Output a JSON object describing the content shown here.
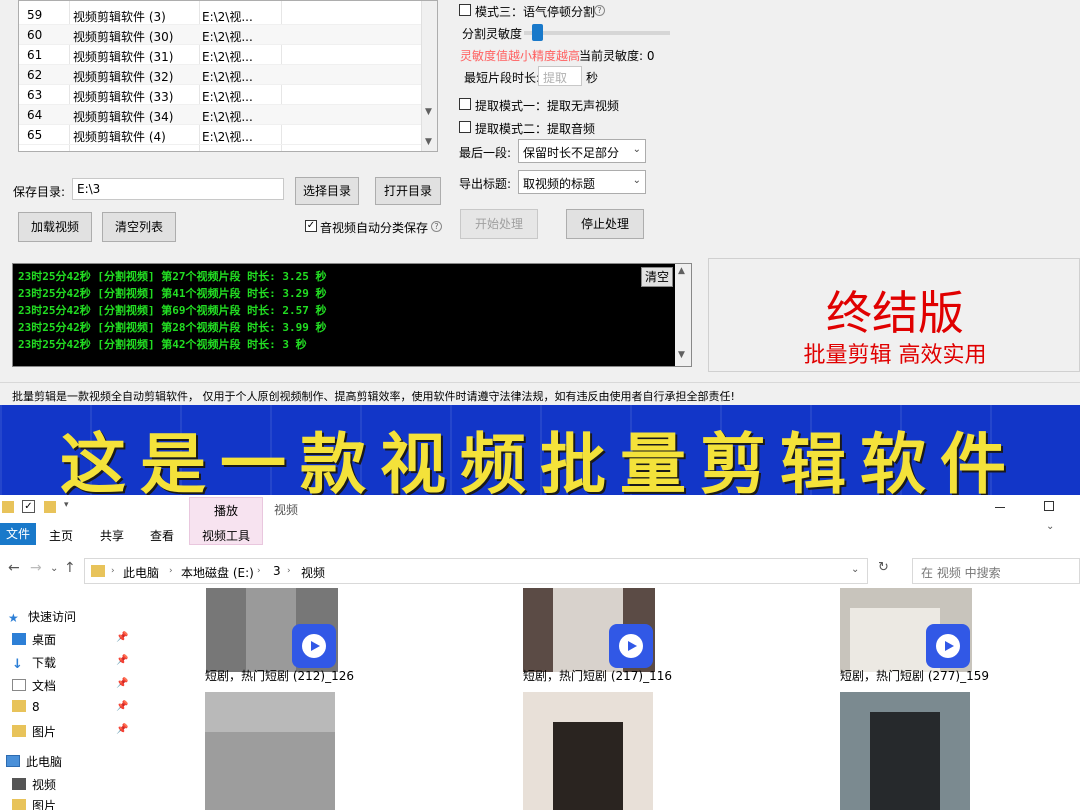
{
  "file_table": {
    "rows": [
      {
        "num": "59",
        "name": "视频剪辑软件 (3)",
        "path": "E:\\2\\视..."
      },
      {
        "num": "60",
        "name": "视频剪辑软件 (30)",
        "path": "E:\\2\\视..."
      },
      {
        "num": "61",
        "name": "视频剪辑软件 (31)",
        "path": "E:\\2\\视..."
      },
      {
        "num": "62",
        "name": "视频剪辑软件 (32)",
        "path": "E:\\2\\视..."
      },
      {
        "num": "63",
        "name": "视频剪辑软件 (33)",
        "path": "E:\\2\\视..."
      },
      {
        "num": "64",
        "name": "视频剪辑软件 (34)",
        "path": "E:\\2\\视..."
      },
      {
        "num": "65",
        "name": "视频剪辑软件 (4)",
        "path": "E:\\2\\视..."
      }
    ]
  },
  "save_dir": {
    "label": "保存目录:",
    "value": "E:\\3",
    "select_button": "选择目录",
    "open_button": "打开目录"
  },
  "buttons": {
    "add_video": "加载视频",
    "clear_list": "清空列表",
    "start": "开始处理",
    "stop": "停止处理",
    "clear_log": "清空"
  },
  "auto_classify": {
    "label": "音视频自动分类保存",
    "checked": true
  },
  "right_panel": {
    "mode3_label": "模式三：语气停顿分割",
    "sensitivity_label": "分割灵敏度",
    "sensitivity_hint": "灵敏度值越小精度越高",
    "current_sensitivity": "当前灵敏度: 0",
    "min_segment_label": "最短片段时长:",
    "min_segment_placeholder": "提取",
    "seconds_unit": "秒",
    "extract_mode1": "提取模式一：提取无声视频",
    "extract_mode2": "提取模式二：提取音频",
    "last_segment_label": "最后一段:",
    "last_segment_value": "保留时长不足部分",
    "export_title_label": "导出标题:",
    "export_title_value": "取视频的标题"
  },
  "log_lines": [
    "23时25分42秒 [分割视频] 第27个视频片段 时长: 3.25 秒",
    "23时25分42秒 [分割视频] 第41个视频片段 时长: 3.29 秒",
    "23时25分42秒 [分割视频] 第69个视频片段 时长: 2.57 秒",
    "23时25分42秒 [分割视频] 第28个视频片段 时长: 3.99 秒",
    "23时25分42秒 [分割视频] 第42个视频片段 时长: 3 秒"
  ],
  "promo": {
    "title": "终结版",
    "subtitle": "批量剪辑 高效实用"
  },
  "disclaimer": "批量剪辑是一款视频全自动剪辑软件， 仅用于个人原创视频制作、提高剪辑效率，使用软件时请遵守法律法规，如有违反由使用者自行承担全部责任!",
  "banner_text": "这是一款视频批量剪辑软件",
  "explorer": {
    "ribbon": {
      "play_tab": "播放",
      "video_label": "视频",
      "file_tab": "文件",
      "home_tab": "主页",
      "share_tab": "共享",
      "view_tab": "查看",
      "video_tools_tab": "视频工具"
    },
    "breadcrumb": [
      "此电脑",
      "本地磁盘 (E:)",
      "3",
      "视频"
    ],
    "search_placeholder": "在 视频 中搜索",
    "nav_pane": [
      {
        "label": "快速访问",
        "icon": "star-icon"
      },
      {
        "label": "桌面",
        "icon": "desktop-icon"
      },
      {
        "label": "下载",
        "icon": "download-icon"
      },
      {
        "label": "文档",
        "icon": "document-icon"
      },
      {
        "label": "8",
        "icon": "folder-icon"
      },
      {
        "label": "图片",
        "icon": "pictures-icon"
      },
      {
        "label": "此电脑",
        "icon": "computer-icon"
      },
      {
        "label": "视频",
        "icon": "video-folder-icon"
      },
      {
        "label": "图片",
        "icon": "pictures-icon"
      }
    ],
    "files": [
      {
        "caption": "短剧，热门短剧 (212)_126"
      },
      {
        "caption": "短剧，热门短剧 (217)_116"
      },
      {
        "caption": "短剧，热门短剧 (277)_159"
      }
    ]
  }
}
